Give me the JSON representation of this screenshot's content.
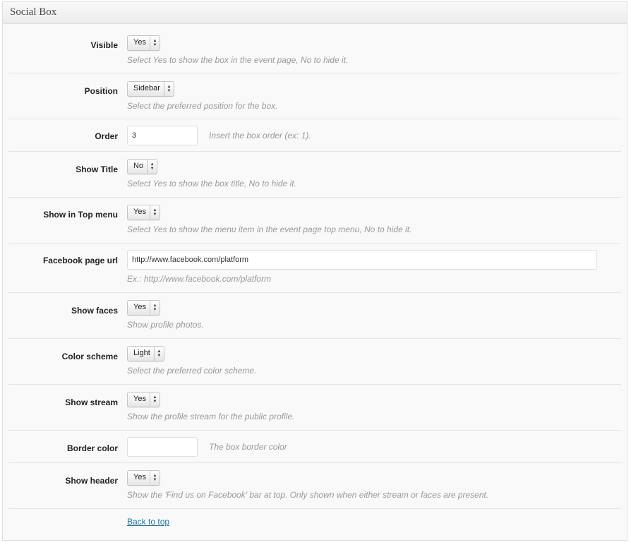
{
  "panel": {
    "title": "Social Box"
  },
  "fields": {
    "visible": {
      "label": "Visible",
      "value": "Yes",
      "desc": "Select Yes to show the box in the event page, No to hide it."
    },
    "position": {
      "label": "Position",
      "value": "Sidebar",
      "desc": "Select the preferred position for the box."
    },
    "order": {
      "label": "Order",
      "value": "3",
      "desc": "Insert the box order (ex: 1)."
    },
    "show_title": {
      "label": "Show Title",
      "value": "No",
      "desc": "Select Yes to show the box title, No to hide it."
    },
    "show_top_menu": {
      "label": "Show in Top menu",
      "value": "Yes",
      "desc": "Select Yes to show the menu item in the event page top menu, No to hide it."
    },
    "facebook_url": {
      "label": "Facebook page url",
      "value": "http://www.facebook.com/platform",
      "desc": "Ex.: http://www.facebook.com/platform"
    },
    "show_faces": {
      "label": "Show faces",
      "value": "Yes",
      "desc": "Show profile photos."
    },
    "color_scheme": {
      "label": "Color scheme",
      "value": "Light",
      "desc": "Select the preferred color scheme."
    },
    "show_stream": {
      "label": "Show stream",
      "value": "Yes",
      "desc": "Show the profile stream for the public profile."
    },
    "border_color": {
      "label": "Border color",
      "value": "",
      "desc": "The box border color"
    },
    "show_header": {
      "label": "Show header",
      "value": "Yes",
      "desc": "Show the 'Find us on Facebook' bar at top. Only shown when either stream or faces are present."
    }
  },
  "footer": {
    "back_link": "Back to top"
  },
  "icons": {
    "select_arrows": "updown-arrows-icon"
  },
  "colors": {
    "link": "#21759b",
    "desc_text": "#999999",
    "panel_bg": "#f9f9f9"
  }
}
